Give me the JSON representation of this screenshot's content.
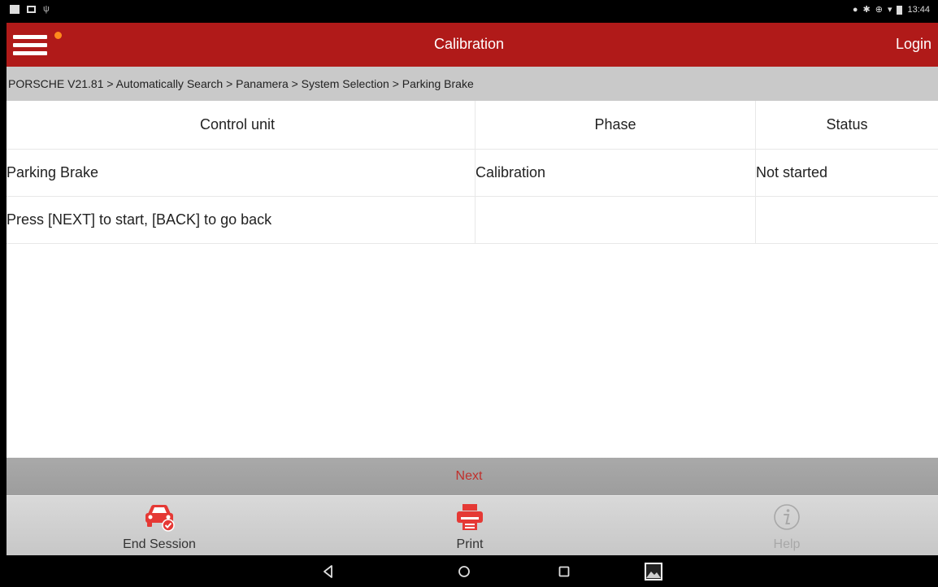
{
  "status_bar": {
    "time": "13:44",
    "left_icons": [
      "notification-icon",
      "screenshot-icon",
      "usb-icon"
    ],
    "right_icons": [
      "location-icon",
      "bluetooth-icon",
      "sync-icon",
      "wifi-icon",
      "battery-icon"
    ]
  },
  "app_bar": {
    "title": "Calibration",
    "login_label": "Login",
    "menu_icon": "hamburger-menu-icon",
    "notification_dot_color": "#ff8a1c",
    "background_color": "#b01a19"
  },
  "breadcrumb": {
    "text": "PORSCHE V21.81 > Automatically Search > Panamera > System Selection > Parking Brake"
  },
  "table": {
    "columns": [
      "Control unit",
      "Phase",
      "Status"
    ],
    "rows": [
      [
        "Parking Brake",
        "Calibration",
        "Not started"
      ],
      [
        "Press [NEXT] to start, [BACK] to go back",
        "",
        ""
      ]
    ]
  },
  "actions": {
    "next_label": "Next",
    "next_color": "#c0302c"
  },
  "toolbar": {
    "end_session_label": "End Session",
    "end_session_icon": "car-check-icon",
    "print_label": "Print",
    "print_icon": "printer-icon",
    "help_label": "Help",
    "help_icon": "info-icon",
    "accent_color": "#e53935"
  },
  "nav_bar": {
    "icons": [
      "back-icon",
      "home-icon",
      "recents-icon",
      "gallery-icon"
    ]
  }
}
